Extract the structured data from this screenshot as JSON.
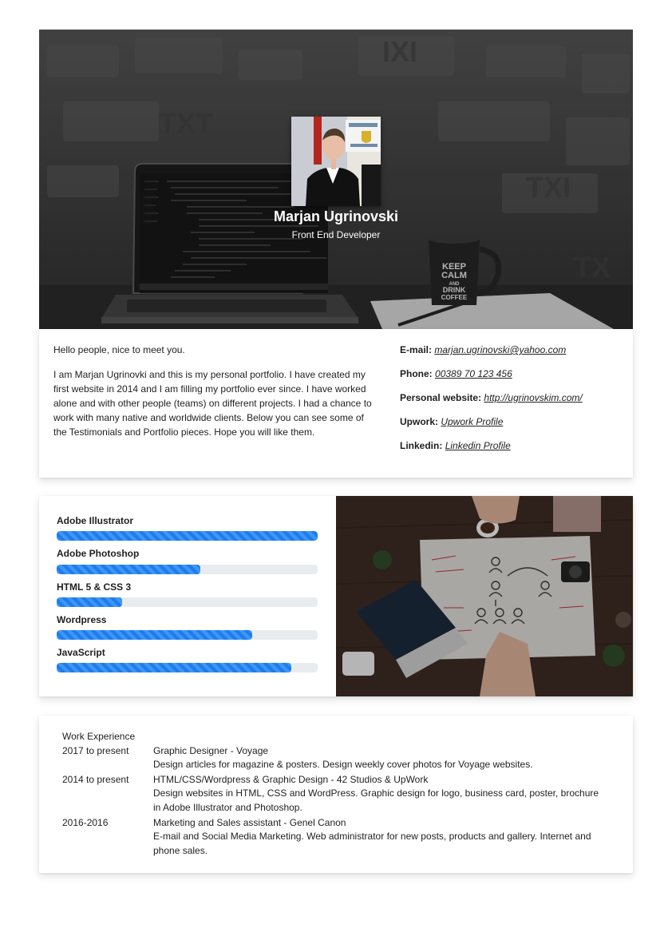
{
  "hero": {
    "name": "Marjan Ugrinovski",
    "role": "Front End Developer",
    "mug_text": [
      "KEEP",
      "CALM",
      "AND",
      "DRINK",
      "COFFEE"
    ]
  },
  "about": {
    "greeting": "Hello people, nice to meet you.",
    "bio": "I am Marjan Ugrinovki and this is my personal portfolio. I have created my first website in 2014 and I am filling my portfolio ever since. I have worked alone and with other people (teams) on different projects. I had a chance to work with many native and worldwide clients. Below you can see some of the Testimonials and Portfolio pieces. Hope you will like them."
  },
  "contacts": [
    {
      "label": "E-mail:",
      "value": "marjan.ugrinovski@yahoo.com"
    },
    {
      "label": "Phone:",
      "value": "00389 70 123 456"
    },
    {
      "label": "Personal website:",
      "value": "http://ugrinovskim.com/"
    },
    {
      "label": "Upwork:",
      "value": "Upwork Profile"
    },
    {
      "label": "Linkedin:",
      "value": "Linkedin Profile"
    }
  ],
  "skills": [
    {
      "name": "Adobe Illustrator",
      "level": 1.0
    },
    {
      "name": "Adobe Photoshop",
      "level": 0.55
    },
    {
      "name": "HTML 5 & CSS 3",
      "level": 0.25
    },
    {
      "name": "Wordpress",
      "level": 0.75
    },
    {
      "name": "JavaScript",
      "level": 0.9
    }
  ],
  "experience": {
    "title": "Work Experience",
    "items": [
      {
        "period": "2017 to present",
        "role": "Graphic Designer - Voyage",
        "description": "Design articles for magazine & posters. Design weekly cover photos for Voyage websites."
      },
      {
        "period": "2014 to present",
        "role": "HTML/CSS/Wordpress & Graphic Design - 42 Studios & UpWork",
        "description": "Design websites in HTML, CSS and WordPress. Graphic design for logo, business card, poster, brochure in Adobe Illustrator and Photoshop."
      },
      {
        "period": "2016-2016",
        "role": "Marketing and Sales assistant - Genel Canon",
        "description": "E-mail and Social Media Marketing. Web administrator for new posts, products and gallery. Internet and phone sales."
      }
    ]
  },
  "colors": {
    "accent": "#1a7ef0",
    "track": "#e9ecef",
    "hero_overlay": "#2e2e2e"
  }
}
